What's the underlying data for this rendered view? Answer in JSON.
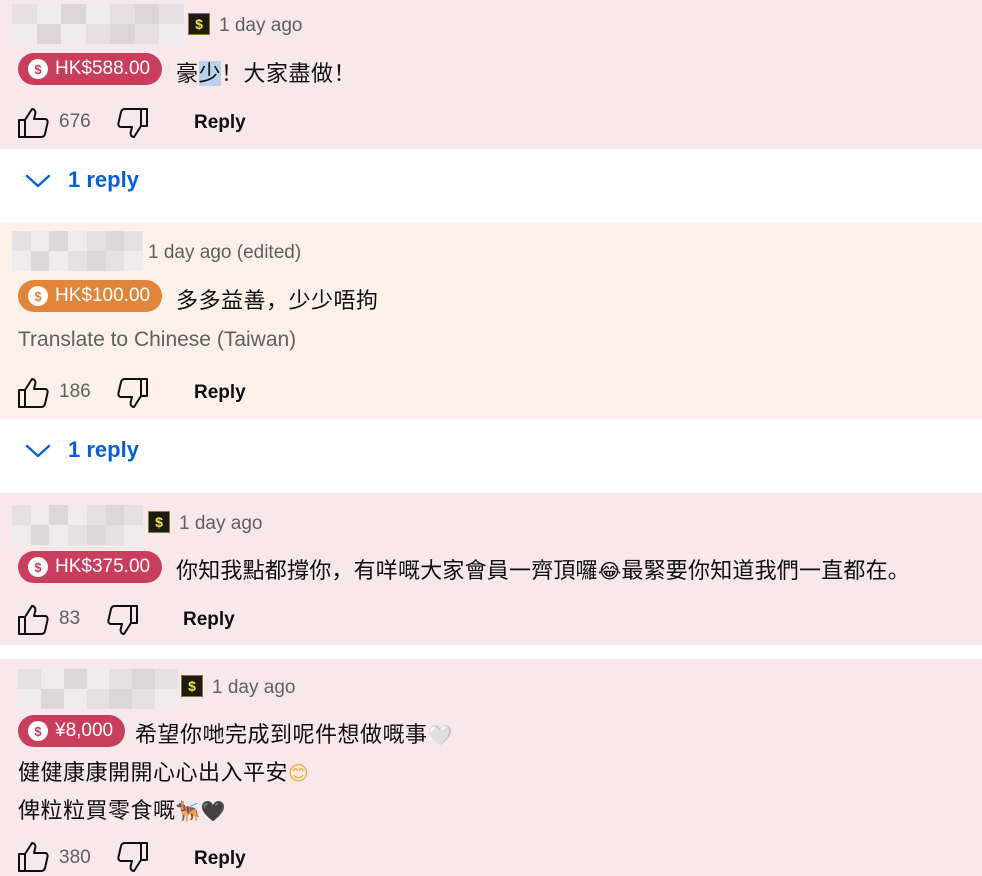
{
  "comments": [
    {
      "time": "1 day ago",
      "amount": "HK$588.00",
      "text_pre": "豪",
      "text_highlight": "少",
      "text_post": "！大家盡做！",
      "likes": "676",
      "reply_label": "Reply",
      "replies": "1 reply"
    },
    {
      "time": "1 day ago (edited)",
      "amount": "HK$100.00",
      "text": "多多益善，少少唔拘",
      "translate": "Translate to Chinese (Taiwan)",
      "likes": "186",
      "reply_label": "Reply",
      "replies": "1 reply"
    },
    {
      "time": "1 day ago",
      "amount": "HK$375.00",
      "text_a": "你知我點都撐你，有咩嘅大家會員一齊頂囉",
      "emoji_a": "😂",
      "text_b": "最緊要你知道我們一直都在。",
      "likes": "83",
      "reply_label": "Reply"
    },
    {
      "time": "1 day ago",
      "amount": "¥8,000",
      "line1": "希望你哋完成到呢件想做嘅事",
      "line1_emoji": "🤍",
      "line2": "健健康康開開心心出入平安",
      "line2_emoji": "😊",
      "line3": "俾粒粒買零食嘅",
      "line3_emoji": "🐕‍🦺🖤",
      "likes": "380",
      "reply_label": "Reply"
    }
  ],
  "colors": {
    "pink_bg": "#f8e8ec",
    "orange_bg": "#fdf0e8",
    "red_pill": "#c93d5d",
    "orange_pill": "#e0853a",
    "link_blue": "#065fd4"
  },
  "icons": [
    "member-badge-icon",
    "coin-icon",
    "like-icon",
    "dislike-icon",
    "chevron-down-icon"
  ]
}
